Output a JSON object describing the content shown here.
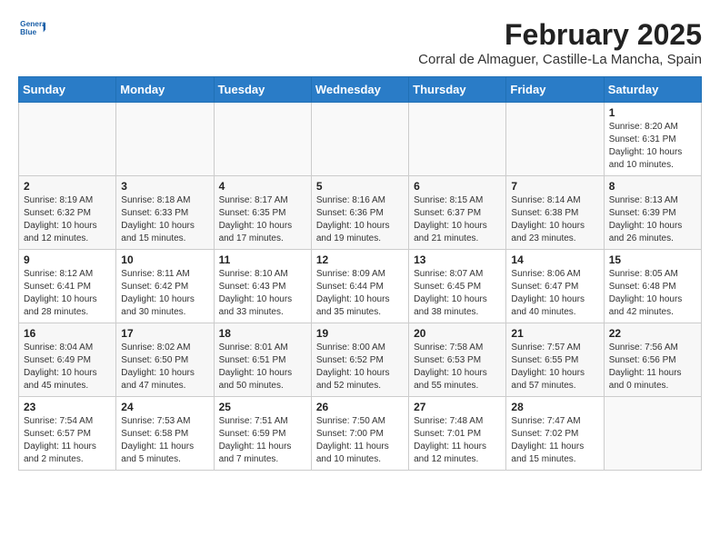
{
  "header": {
    "month_year": "February 2025",
    "location": "Corral de Almaguer, Castille-La Mancha, Spain"
  },
  "logo": {
    "line1": "General",
    "line2": "Blue"
  },
  "days_of_week": [
    "Sunday",
    "Monday",
    "Tuesday",
    "Wednesday",
    "Thursday",
    "Friday",
    "Saturday"
  ],
  "weeks": [
    [
      {
        "day": "",
        "info": ""
      },
      {
        "day": "",
        "info": ""
      },
      {
        "day": "",
        "info": ""
      },
      {
        "day": "",
        "info": ""
      },
      {
        "day": "",
        "info": ""
      },
      {
        "day": "",
        "info": ""
      },
      {
        "day": "1",
        "info": "Sunrise: 8:20 AM\nSunset: 6:31 PM\nDaylight: 10 hours and 10 minutes."
      }
    ],
    [
      {
        "day": "2",
        "info": "Sunrise: 8:19 AM\nSunset: 6:32 PM\nDaylight: 10 hours and 12 minutes."
      },
      {
        "day": "3",
        "info": "Sunrise: 8:18 AM\nSunset: 6:33 PM\nDaylight: 10 hours and 15 minutes."
      },
      {
        "day": "4",
        "info": "Sunrise: 8:17 AM\nSunset: 6:35 PM\nDaylight: 10 hours and 17 minutes."
      },
      {
        "day": "5",
        "info": "Sunrise: 8:16 AM\nSunset: 6:36 PM\nDaylight: 10 hours and 19 minutes."
      },
      {
        "day": "6",
        "info": "Sunrise: 8:15 AM\nSunset: 6:37 PM\nDaylight: 10 hours and 21 minutes."
      },
      {
        "day": "7",
        "info": "Sunrise: 8:14 AM\nSunset: 6:38 PM\nDaylight: 10 hours and 23 minutes."
      },
      {
        "day": "8",
        "info": "Sunrise: 8:13 AM\nSunset: 6:39 PM\nDaylight: 10 hours and 26 minutes."
      }
    ],
    [
      {
        "day": "9",
        "info": "Sunrise: 8:12 AM\nSunset: 6:41 PM\nDaylight: 10 hours and 28 minutes."
      },
      {
        "day": "10",
        "info": "Sunrise: 8:11 AM\nSunset: 6:42 PM\nDaylight: 10 hours and 30 minutes."
      },
      {
        "day": "11",
        "info": "Sunrise: 8:10 AM\nSunset: 6:43 PM\nDaylight: 10 hours and 33 minutes."
      },
      {
        "day": "12",
        "info": "Sunrise: 8:09 AM\nSunset: 6:44 PM\nDaylight: 10 hours and 35 minutes."
      },
      {
        "day": "13",
        "info": "Sunrise: 8:07 AM\nSunset: 6:45 PM\nDaylight: 10 hours and 38 minutes."
      },
      {
        "day": "14",
        "info": "Sunrise: 8:06 AM\nSunset: 6:47 PM\nDaylight: 10 hours and 40 minutes."
      },
      {
        "day": "15",
        "info": "Sunrise: 8:05 AM\nSunset: 6:48 PM\nDaylight: 10 hours and 42 minutes."
      }
    ],
    [
      {
        "day": "16",
        "info": "Sunrise: 8:04 AM\nSunset: 6:49 PM\nDaylight: 10 hours and 45 minutes."
      },
      {
        "day": "17",
        "info": "Sunrise: 8:02 AM\nSunset: 6:50 PM\nDaylight: 10 hours and 47 minutes."
      },
      {
        "day": "18",
        "info": "Sunrise: 8:01 AM\nSunset: 6:51 PM\nDaylight: 10 hours and 50 minutes."
      },
      {
        "day": "19",
        "info": "Sunrise: 8:00 AM\nSunset: 6:52 PM\nDaylight: 10 hours and 52 minutes."
      },
      {
        "day": "20",
        "info": "Sunrise: 7:58 AM\nSunset: 6:53 PM\nDaylight: 10 hours and 55 minutes."
      },
      {
        "day": "21",
        "info": "Sunrise: 7:57 AM\nSunset: 6:55 PM\nDaylight: 10 hours and 57 minutes."
      },
      {
        "day": "22",
        "info": "Sunrise: 7:56 AM\nSunset: 6:56 PM\nDaylight: 11 hours and 0 minutes."
      }
    ],
    [
      {
        "day": "23",
        "info": "Sunrise: 7:54 AM\nSunset: 6:57 PM\nDaylight: 11 hours and 2 minutes."
      },
      {
        "day": "24",
        "info": "Sunrise: 7:53 AM\nSunset: 6:58 PM\nDaylight: 11 hours and 5 minutes."
      },
      {
        "day": "25",
        "info": "Sunrise: 7:51 AM\nSunset: 6:59 PM\nDaylight: 11 hours and 7 minutes."
      },
      {
        "day": "26",
        "info": "Sunrise: 7:50 AM\nSunset: 7:00 PM\nDaylight: 11 hours and 10 minutes."
      },
      {
        "day": "27",
        "info": "Sunrise: 7:48 AM\nSunset: 7:01 PM\nDaylight: 11 hours and 12 minutes."
      },
      {
        "day": "28",
        "info": "Sunrise: 7:47 AM\nSunset: 7:02 PM\nDaylight: 11 hours and 15 minutes."
      },
      {
        "day": "",
        "info": ""
      }
    ]
  ]
}
